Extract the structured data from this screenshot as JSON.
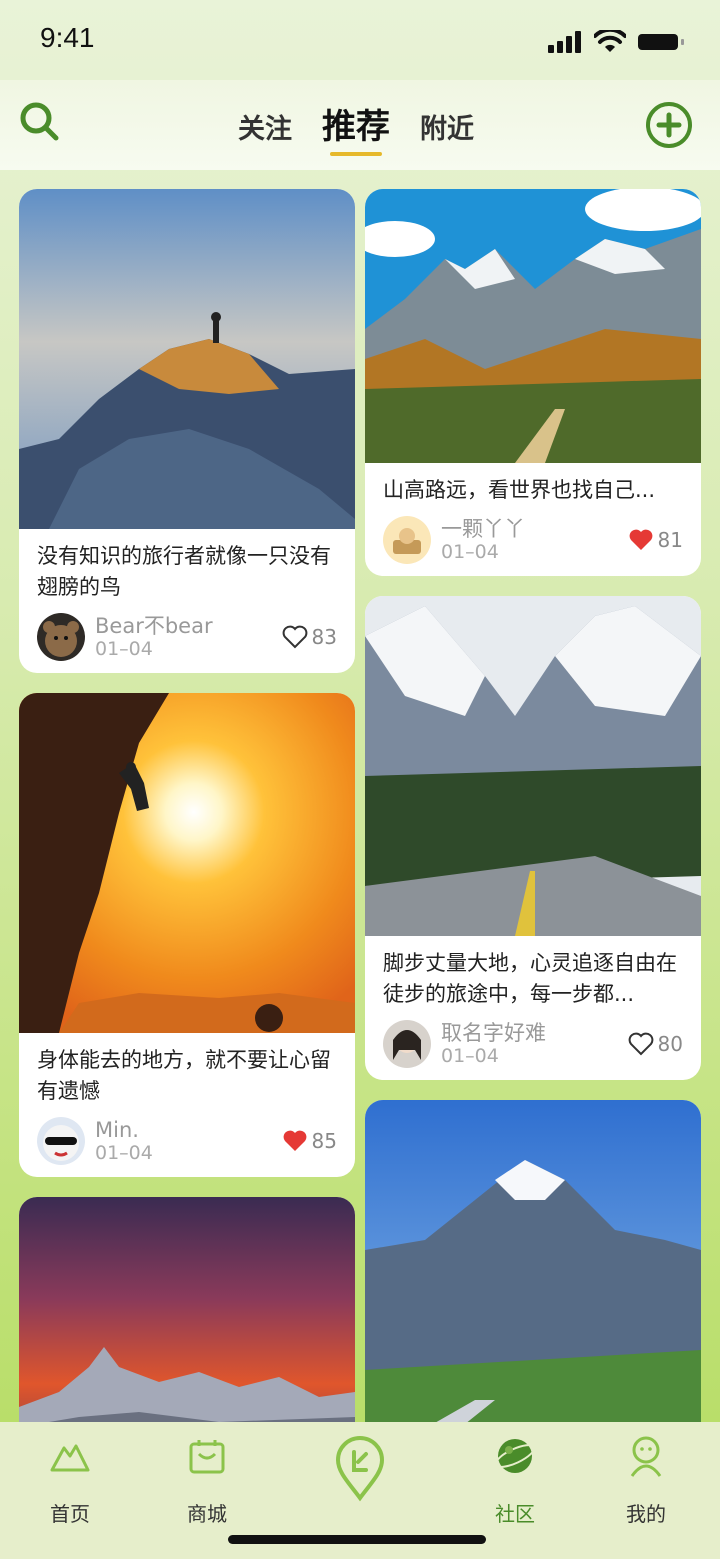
{
  "status_bar": {
    "time": "9:41"
  },
  "header": {
    "tabs": [
      "关注",
      "推荐",
      "附近"
    ],
    "active_tab": "推荐"
  },
  "colors": {
    "accent_green": "#4a8c2a",
    "tab_underline": "#e6b82a",
    "like_red": "#e53935"
  },
  "feed": {
    "left": [
      {
        "title": "没有知识的旅行者就像一只没有翅膀的鸟",
        "author": "Bear不bear",
        "date": "01–04",
        "likes": "83",
        "liked": false
      },
      {
        "title": "身体能去的地方，就不要让心留有遗憾",
        "author": "Min.",
        "date": "01–04",
        "likes": "85",
        "liked": true
      }
    ],
    "right": [
      {
        "title": "山高路远，看世界也找自己...",
        "author": "一颗丫丫",
        "date": "01–04",
        "likes": "81",
        "liked": true
      },
      {
        "title": "脚步丈量大地，心灵追逐自由在徒步的旅途中，每一步都...",
        "author": "取名字好难",
        "date": "01–04",
        "likes": "80",
        "liked": false
      }
    ]
  },
  "bottom_nav": {
    "items": [
      "首页",
      "商城",
      "社区",
      "我的"
    ],
    "active": "社区"
  }
}
